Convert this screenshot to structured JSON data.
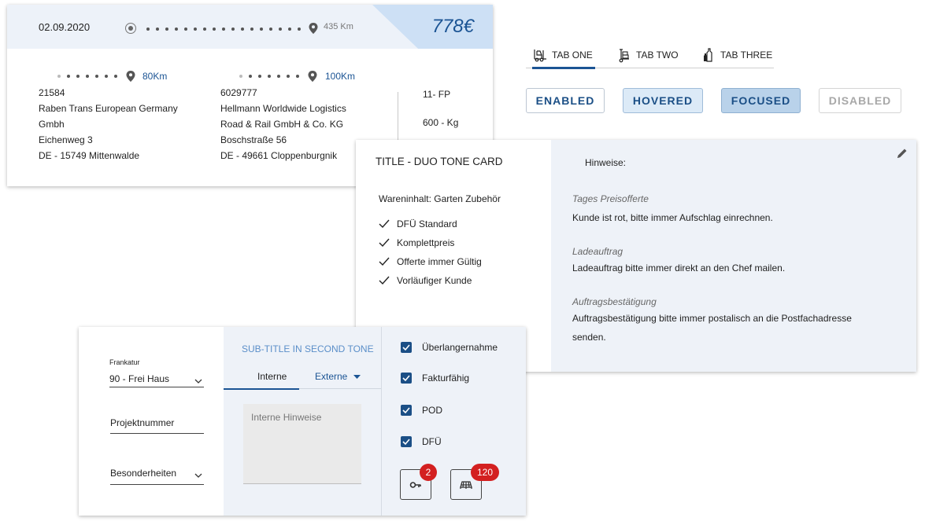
{
  "shipment": {
    "date": "02.09.2020",
    "total_distance": "435 Km",
    "price": "778€",
    "origin": {
      "distance": "80Km",
      "lines": [
        "21584",
        "Raben Trans European Germany",
        "Gmbh",
        "Eichenweg 3",
        "DE - 15749 Mittenwalde"
      ]
    },
    "destination": {
      "distance": "100Km",
      "lines": [
        "6029777",
        "Hellmann Worldwide Logistics",
        "Road & Rail GmbH & Co. KG",
        "Boschstraße 56",
        "DE - 49661 Cloppenburgnik"
      ]
    },
    "pallets": "11- FP",
    "weight": "600 - Kg"
  },
  "tabs": [
    {
      "label": "TAB ONE",
      "icon": "forklift-icon",
      "active": true
    },
    {
      "label": "TAB TWO",
      "icon": "hand-truck-icon",
      "active": false
    },
    {
      "label": "TAB THREE",
      "icon": "bottles-icon",
      "active": false
    }
  ],
  "buttons": {
    "enabled": "ENABLED",
    "hovered": "HOVERED",
    "focused": "FOCUSED",
    "disabled": "DISABLED"
  },
  "duo_card": {
    "title": "TITLE - DUO TONE CARD",
    "content": "Wareninhalt: Garten Zubehör",
    "checks": [
      "DFÜ Standard",
      "Komplettpreis",
      "Offerte immer Gültig",
      "Vorläufiger Kunde"
    ],
    "notes_heading": "Hinweise:",
    "notes": [
      {
        "title": "Tages Preisofferte",
        "text": "Kunde ist rot, bitte immer Aufschlag einrechnen."
      },
      {
        "title": "Ladeauftrag",
        "text": "Ladeauftrag bitte immer direkt an den Chef mailen."
      },
      {
        "title": "Auftragsbestätigung",
        "text": "Auftragsbestätigung bitte immer postalisch an die Postfachadresse senden."
      }
    ]
  },
  "form": {
    "frankatur_label": "Frankatur",
    "frankatur_value": "90 - Frei Haus",
    "projektnummer": "Projektnummer",
    "besonderheiten": "Besonderheiten",
    "subtitle": "SUB-TITLE IN SECOND TONE",
    "tab_intern": "Interne",
    "tab_extern": "Externe",
    "textarea_placeholder": "Interne Hinweise",
    "checkboxes": [
      "Überlangernahme",
      "Fakturfähig",
      "POD",
      "DFÜ"
    ],
    "key_badge": "2",
    "pallet_badge": "120"
  },
  "colors": {
    "accent": "#1b5494",
    "badge": "#d32020",
    "duo_tone": "#eef2f8"
  }
}
